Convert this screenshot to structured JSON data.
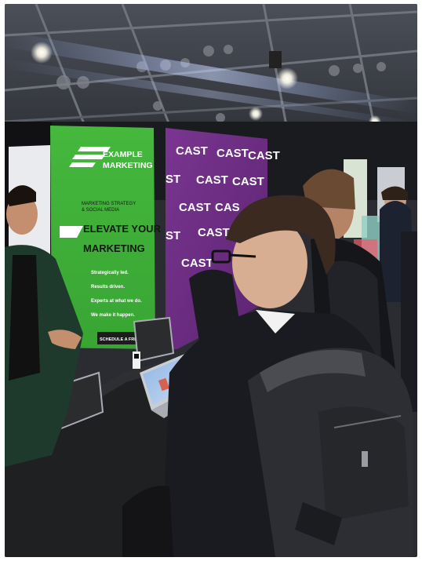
{
  "photo": {
    "green_banner": {
      "brand_line1": "EXAMPLE",
      "brand_line2": "MARKETING",
      "tagline_line1": "MARKETING STRATEGY",
      "tagline_line2": "& SOCIAL MEDIA",
      "headline_line1": "ELEVATE YOUR",
      "headline_line2": "MARKETING",
      "bullet1": "Strategically led.",
      "bullet2": "Results driven.",
      "bullet3": "Experts at what we do.",
      "bullet4": "We make it happen.",
      "cta": "SCHEDULE A FREE CALL"
    },
    "purple_banner": {
      "word": "CAST",
      "partial": "ST",
      "partial_right": "CAS"
    },
    "colors": {
      "green": "#3fae3a",
      "purple": "#6a2c7e",
      "ceiling": "#3b3e46",
      "table": "#1f2022"
    }
  }
}
